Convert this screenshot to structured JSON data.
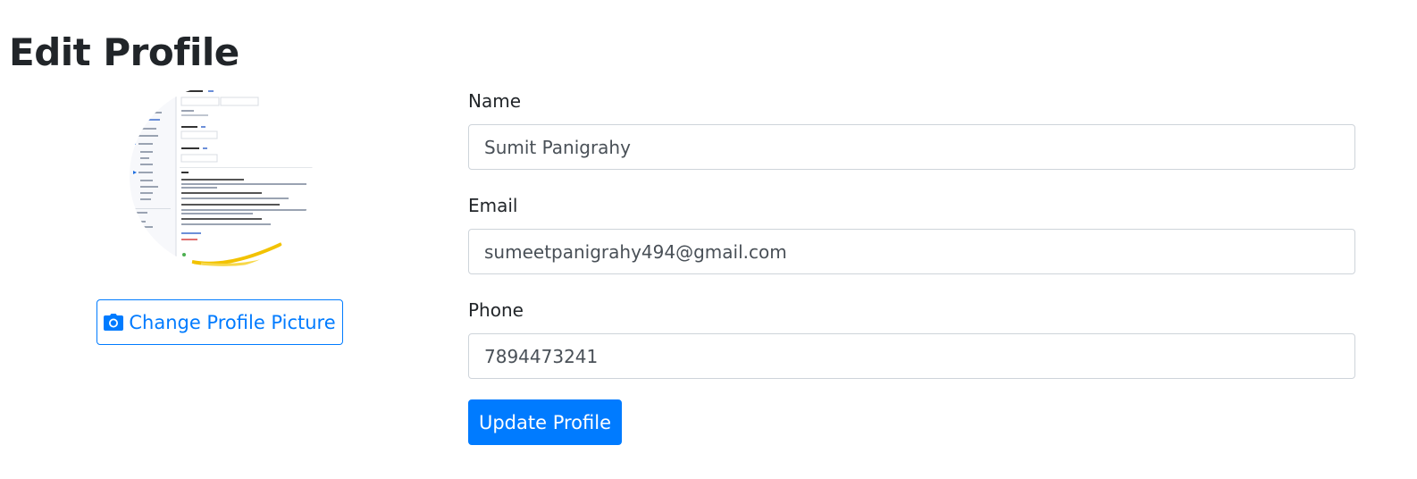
{
  "page": {
    "title": "Edit Profile"
  },
  "avatar": {
    "icon": "profile-picture"
  },
  "change_picture_button": {
    "icon": "camera-icon",
    "label": "Change Profile Picture"
  },
  "form": {
    "fields": [
      {
        "label": "Name",
        "value": "Sumit Panigrahy"
      },
      {
        "label": "Email",
        "value": "sumeetpanigrahy494@gmail.com"
      },
      {
        "label": "Phone",
        "value": "7894473241"
      }
    ],
    "submit_label": "Update Profile"
  },
  "colors": {
    "primary": "#007bff",
    "text": "#212529",
    "input_border": "#ced4da",
    "input_text": "#495057"
  }
}
